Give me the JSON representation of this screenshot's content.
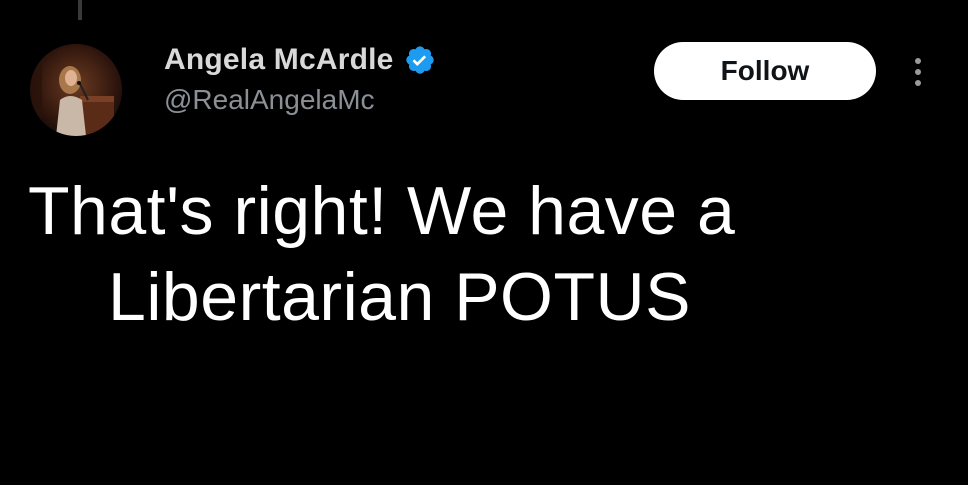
{
  "author": {
    "display_name": "Angela McArdle",
    "handle": "@RealAngelaMc",
    "verified": true,
    "verified_color": "#1d9bf0"
  },
  "actions": {
    "follow_label": "Follow",
    "more_icon": "more-vertical-icon"
  },
  "tweet": {
    "line_1": "That's right! We have a",
    "line_2": "Libertarian POTUS"
  },
  "colors": {
    "background": "#000000",
    "text": "#ffffff",
    "handle": "#8b9096",
    "follow_bg": "#ffffff",
    "follow_text": "#0f1419"
  }
}
